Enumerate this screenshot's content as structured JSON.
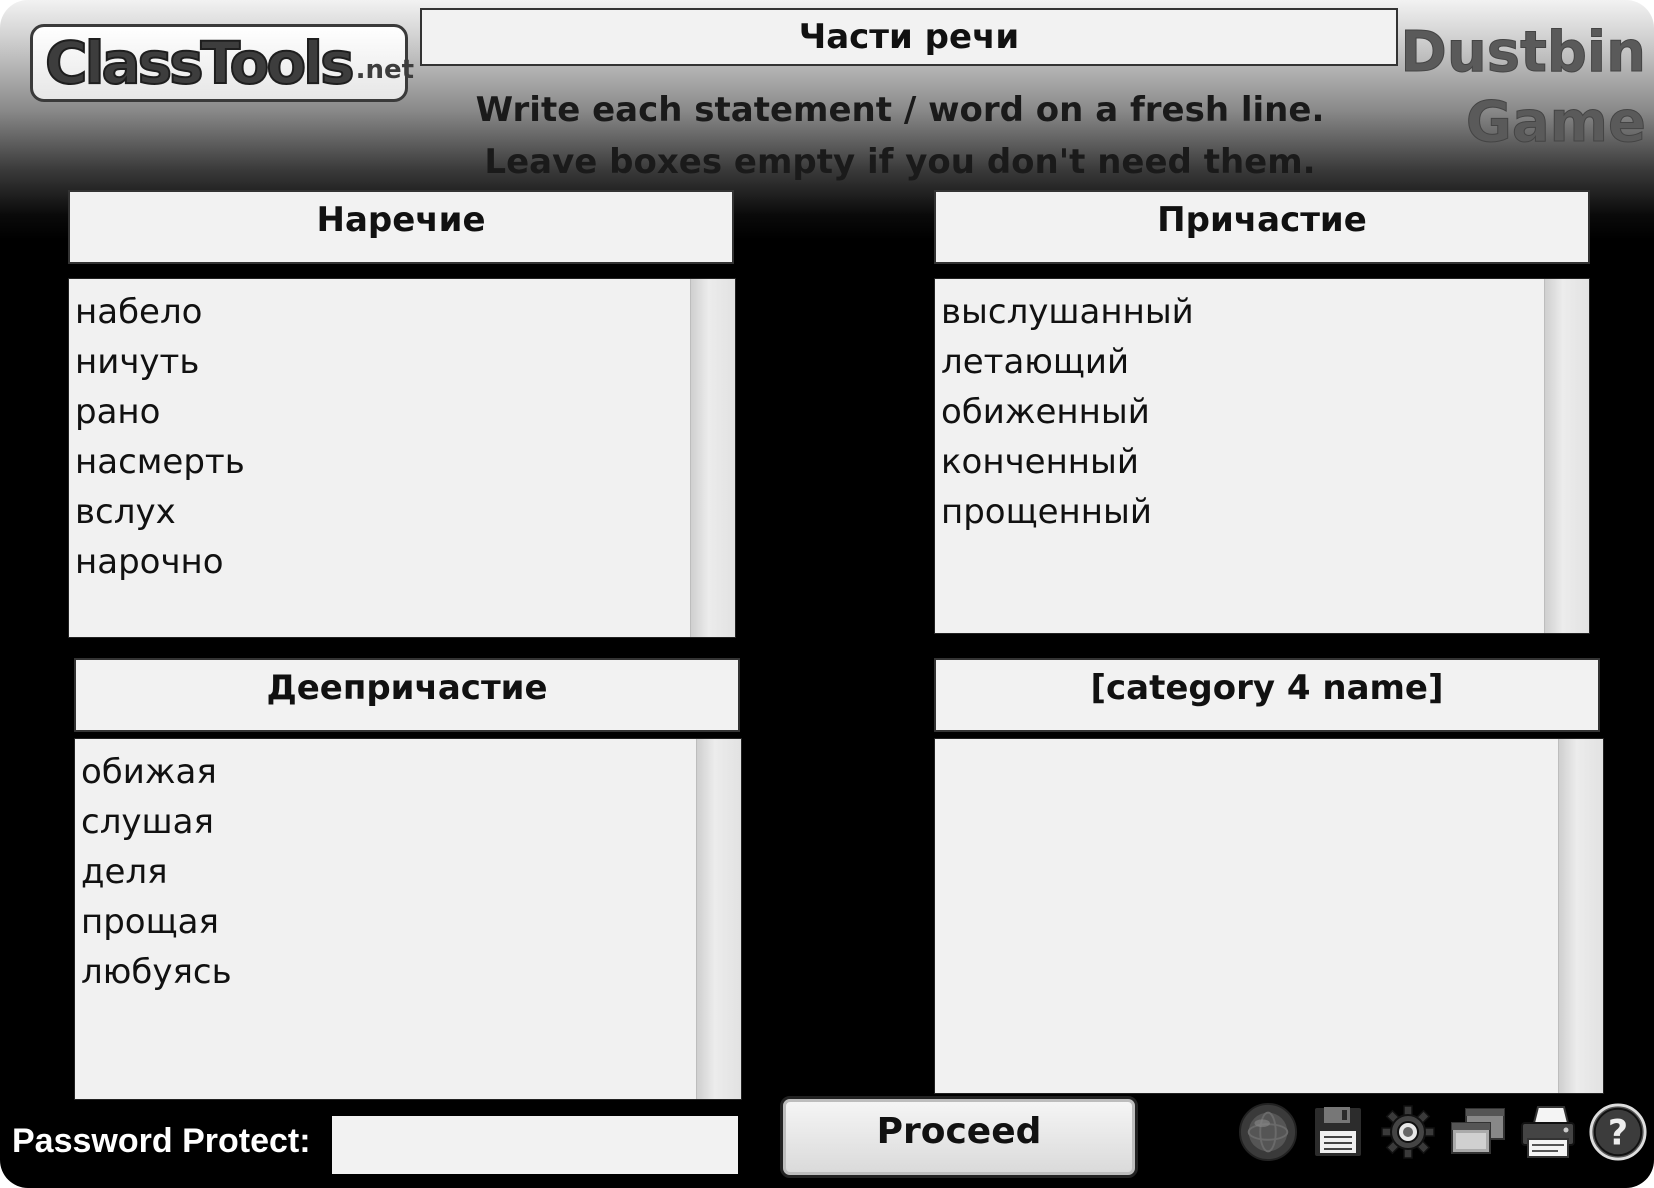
{
  "logo": {
    "text": "ClassTools",
    "suffix": ".net"
  },
  "title": "Части речи",
  "game_title_line1": "Dustbin",
  "game_title_line2": "Game",
  "instructions": {
    "line1": "Write each statement / word on a fresh line.",
    "line2": "Leave boxes empty if you don't need them."
  },
  "categories": [
    {
      "name": "Наречие",
      "items": [
        "набело",
        "ничуть",
        "рано",
        "насмерть",
        "вслух",
        "нарочно"
      ]
    },
    {
      "name": "Причастие",
      "items": [
        "выслушанный",
        "летающий",
        "обиженный",
        "конченный",
        "прощенный"
      ]
    },
    {
      "name": "Деепричастие",
      "items": [
        "обижая",
        "слушая",
        "деля",
        "прощая",
        "любуясь"
      ]
    },
    {
      "name": "[category 4 name]",
      "items": []
    }
  ],
  "password": {
    "label": "Password Protect:",
    "value": ""
  },
  "proceed_label": "Proceed",
  "toolbar": {
    "icons": [
      "globe-icon",
      "save-icon",
      "settings-gear-icon",
      "windows-icon",
      "printer-icon",
      "help-icon"
    ]
  }
}
